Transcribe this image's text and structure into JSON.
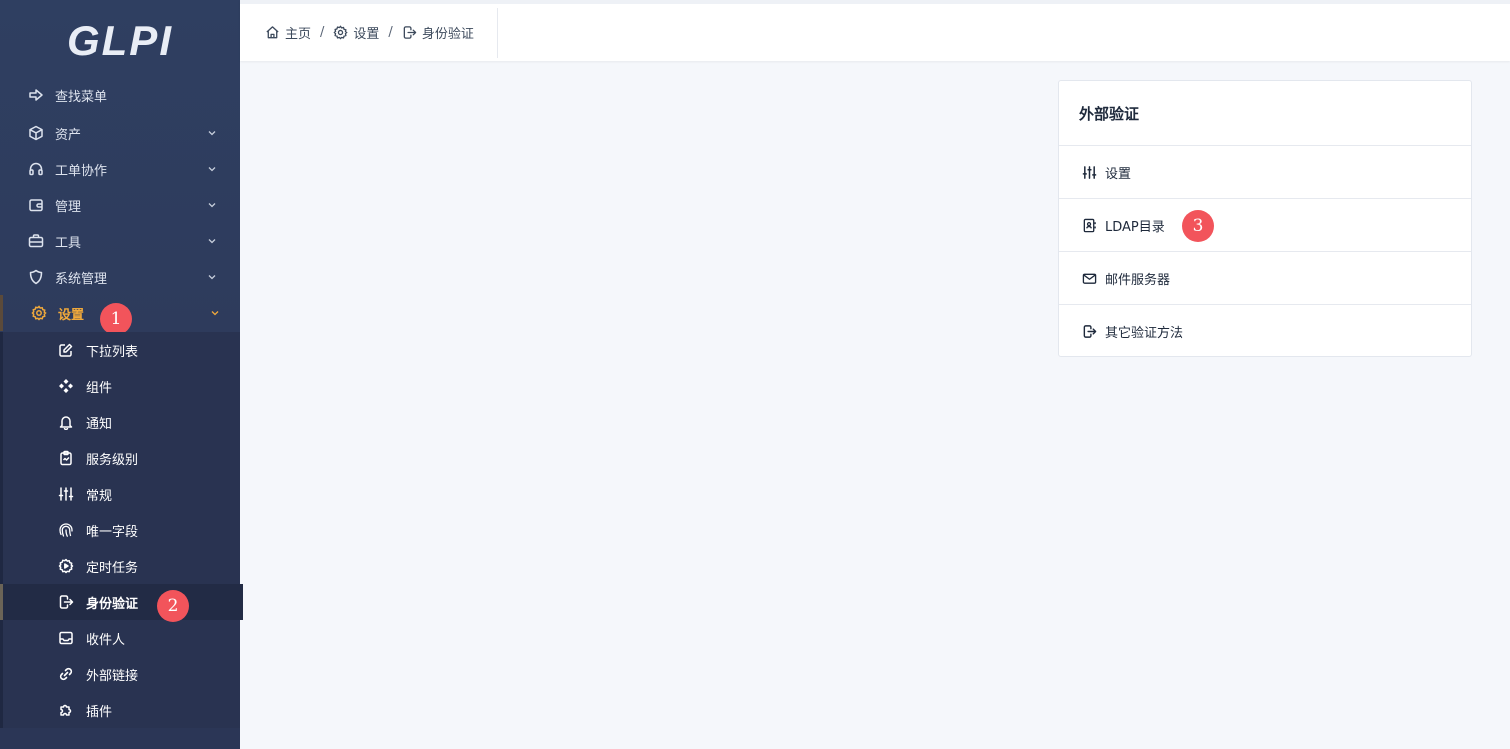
{
  "app": {
    "logo_text": "GLPI"
  },
  "sidebar": {
    "items": [
      {
        "label": "查找菜单",
        "icon": "arrow-right-icon"
      },
      {
        "label": "资产",
        "icon": "box-icon"
      },
      {
        "label": "工单协作",
        "icon": "headset-icon"
      },
      {
        "label": "管理",
        "icon": "wallet-icon"
      },
      {
        "label": "工具",
        "icon": "briefcase-icon"
      },
      {
        "label": "系统管理",
        "icon": "shield-icon"
      },
      {
        "label": "设置",
        "icon": "gear-icon"
      }
    ],
    "submenu": [
      {
        "label": "下拉列表",
        "icon": "edit-icon"
      },
      {
        "label": "组件",
        "icon": "components-icon"
      },
      {
        "label": "通知",
        "icon": "bell-icon"
      },
      {
        "label": "服务级别",
        "icon": "clipboard-icon"
      },
      {
        "label": "常规",
        "icon": "sliders-icon"
      },
      {
        "label": "唯一字段",
        "icon": "fingerprint-icon"
      },
      {
        "label": "定时任务",
        "icon": "settings-automation-icon"
      },
      {
        "label": "身份验证",
        "icon": "login-icon"
      },
      {
        "label": "收件人",
        "icon": "inbox-icon"
      },
      {
        "label": "外部链接",
        "icon": "link-icon"
      },
      {
        "label": "插件",
        "icon": "puzzle-icon"
      }
    ]
  },
  "breadcrumb": {
    "home": "主页",
    "settings": "设置",
    "current": "身份验证",
    "separator": "/"
  },
  "card": {
    "title": "外部验证",
    "items": [
      {
        "label": "设置",
        "icon": "sliders-icon"
      },
      {
        "label": "LDAP目录",
        "icon": "address-book-icon"
      },
      {
        "label": "邮件服务器",
        "icon": "mail-icon"
      },
      {
        "label": "其它验证方法",
        "icon": "login-icon"
      }
    ]
  },
  "annotations": [
    "1",
    "2",
    "3"
  ],
  "colors": {
    "sidebar_bg": "#2e3b5c",
    "active_accent": "#f0a93b",
    "badge": "#f2545b",
    "page_bg": "#f5f7fb"
  }
}
